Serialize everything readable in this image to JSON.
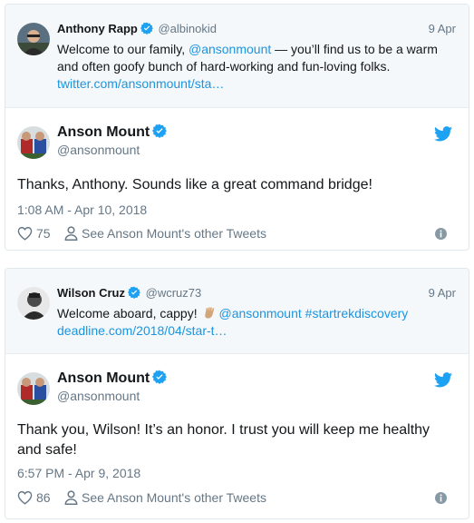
{
  "tweet1": {
    "parent": {
      "name": "Anthony Rapp",
      "handle": "@albinokid",
      "date": "9 Apr",
      "text_line1_pre": "Welcome to our family, ",
      "text_line1_mention": "@ansonmount",
      "text_line1_post": " — you’ll find us to be a warm",
      "text_line2": "and often goofy bunch of hard-working and fun-loving folks.",
      "url": "twitter.com/ansonmount/sta…"
    },
    "reply": {
      "name": "Anson Mount",
      "handle": "@ansonmount",
      "text": "Thanks, Anthony.  Sounds like a great command bridge!",
      "timestamp": "1:08 AM - Apr 10, 2018",
      "likes": "75",
      "see_other": "See Anson Mount's other Tweets"
    }
  },
  "tweet2": {
    "parent": {
      "name": "Wilson Cruz",
      "handle": "@wcruz73",
      "date": "9 Apr",
      "text_pre": "Welcome aboard, cappy! ",
      "text_mention": "@ansonmount",
      "text_hashtag": "#startrekdiscovery",
      "url": "deadline.com/2018/04/star-t…"
    },
    "reply": {
      "name": "Anson Mount",
      "handle": "@ansonmount",
      "text_line1": "Thank you, Wilson!  It’s an honor.  I trust you will keep me healthy",
      "text_line2": "and safe!",
      "timestamp": "6:57 PM - Apr 9, 2018",
      "likes": "86",
      "see_other": "See Anson Mount's other Tweets"
    }
  },
  "icons": [
    "verified-badge-icon",
    "twitter-bird-icon",
    "heart-icon",
    "person-icon",
    "info-icon",
    "vulcan-salute-emoji"
  ],
  "colors": {
    "link": "#1b95e0",
    "muted": "#657786",
    "verified": "#1da1f2",
    "parent_bg": "#f5f8fa"
  }
}
